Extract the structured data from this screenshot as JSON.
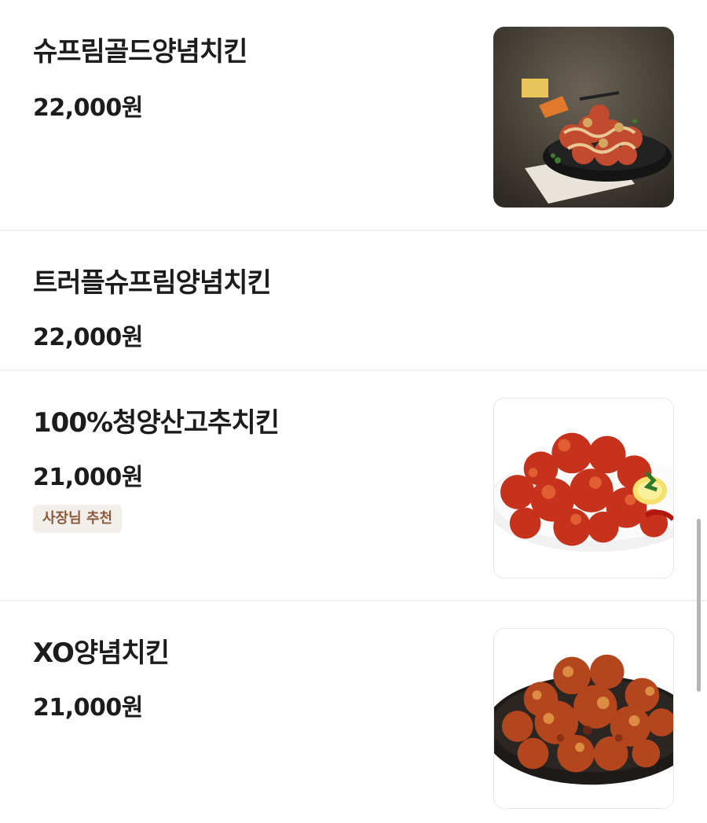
{
  "menu": {
    "items": [
      {
        "name": "슈프림골드양념치킨",
        "price": "22,000원",
        "photo": "supreme-gold-chicken-photo"
      },
      {
        "name": "트러플슈프림양념치킨",
        "price": "22,000원"
      },
      {
        "name": "100%청양산고추치킨",
        "price": "21,000원",
        "badge": "사장님 추천",
        "photo": "cheongyang-pepper-chicken-photo"
      },
      {
        "name": "XO양념치킨",
        "price": "21,000원",
        "photo": "xo-yangnyeom-chicken-photo"
      }
    ]
  },
  "colors": {
    "text": "#1c1c1c",
    "divider": "#efefef",
    "badge_bg": "#f3efea",
    "badge_text": "#8a5a3c"
  }
}
